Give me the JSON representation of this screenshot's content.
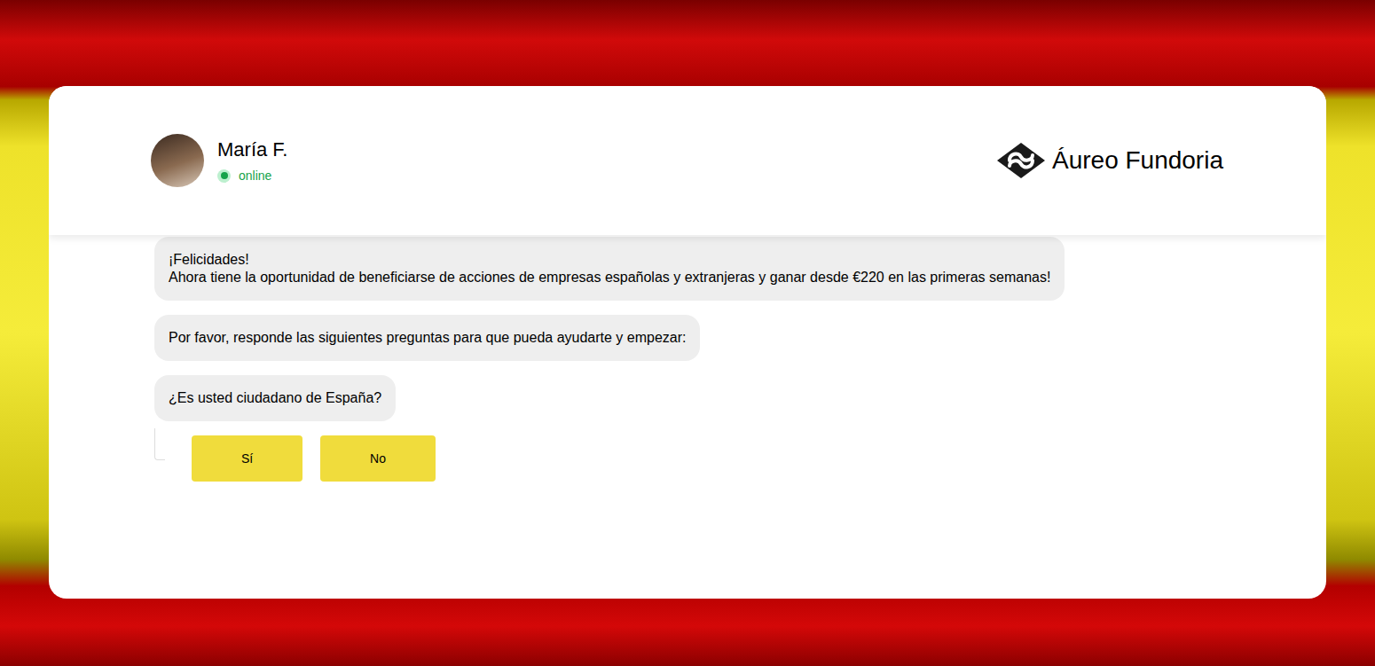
{
  "header": {
    "name": "María F.",
    "status": "online",
    "online": true,
    "brand": "Áureo Fundoria"
  },
  "messages": [
    {
      "lines": [
        "¡Felicidades!",
        "Ahora tiene la oportunidad de beneficiarse de acciones de empresas españolas y extranjeras y ganar desde €220 en las primeras semanas!"
      ]
    },
    {
      "lines": [
        "Por favor, responde las siguientes preguntas para que pueda ayudarte y empezar:"
      ]
    },
    {
      "lines": [
        "¿Es usted ciudadano de España?"
      ]
    }
  ],
  "options": [
    {
      "label": "Sí"
    },
    {
      "label": "No"
    }
  ]
}
